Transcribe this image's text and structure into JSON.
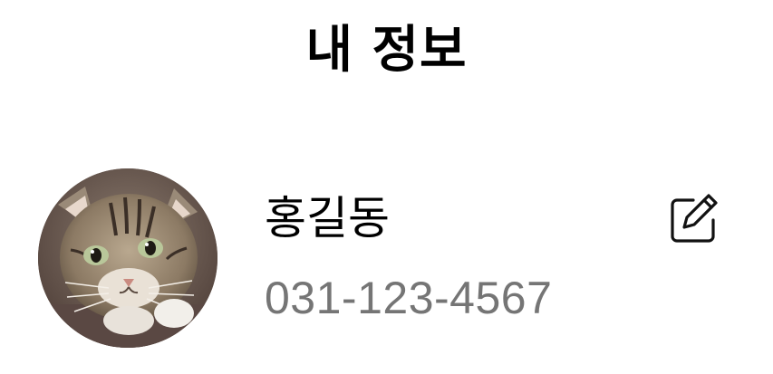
{
  "header": {
    "title": "내 정보"
  },
  "profile": {
    "name": "홍길동",
    "phone": "031-123-4567",
    "avatar_icon": "cat-photo",
    "edit_icon": "edit-pencil-icon"
  },
  "colors": {
    "title": "#000000",
    "name": "#000000",
    "phone": "#757575",
    "icon": "#111111"
  }
}
